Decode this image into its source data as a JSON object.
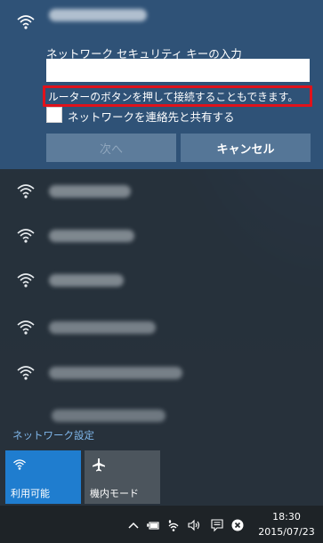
{
  "selected_network": {
    "security_prompt": "ネットワーク セキュリティ キーの入力",
    "key_value": "",
    "wps_hint": "ルーターのボタンを押して接続することもできます。",
    "share_label": "ネットワークを連絡先と共有する",
    "share_checked": false,
    "next_label": "次へ",
    "cancel_label": "キャンセル"
  },
  "network_settings_link": "ネットワーク設定",
  "quick_actions": [
    {
      "label": "利用可能",
      "icon": "wifi-icon",
      "active": true
    },
    {
      "label": "機内モード",
      "icon": "airplane-icon",
      "active": false
    }
  ],
  "taskbar": {
    "time": "18:30",
    "date": "2015/07/23"
  },
  "colors": {
    "accent": "#1f7dcf",
    "highlight_border": "#e0121b",
    "selected_bg": "#2f5277"
  }
}
